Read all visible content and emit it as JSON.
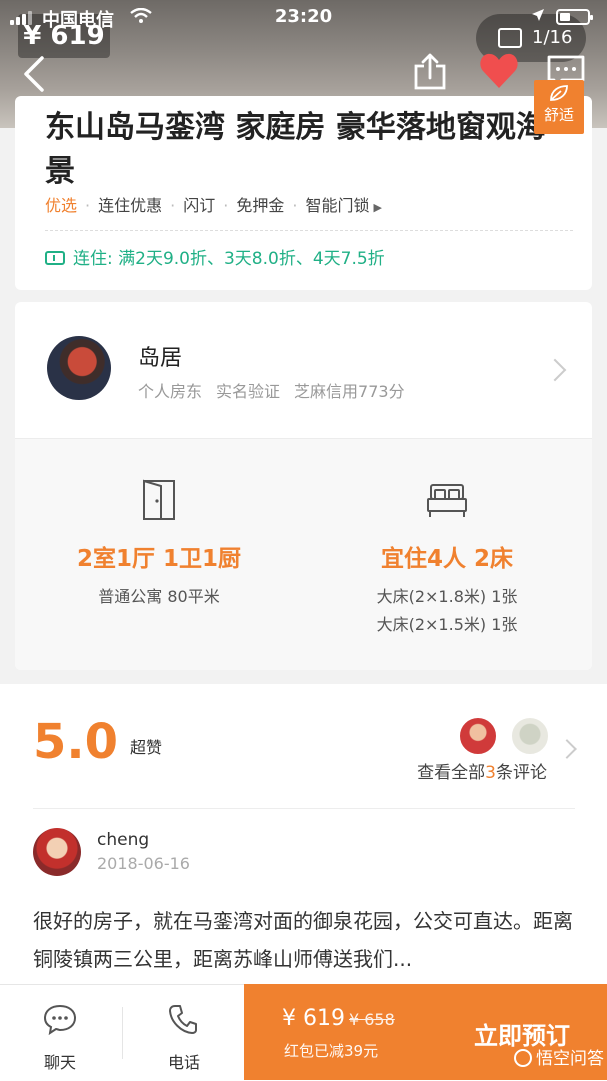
{
  "status_bar": {
    "carrier": "中国电信",
    "time": "23:20"
  },
  "gallery": {
    "price_overlay": "¥ 619",
    "photo_count": "1/16"
  },
  "badge": {
    "label": "舒适"
  },
  "listing": {
    "title": "东山岛马銮湾 家庭房 豪华落地窗观海景",
    "tags": [
      {
        "label": "优选"
      },
      {
        "label": "连住优惠"
      },
      {
        "label": "闪订"
      },
      {
        "label": "免押金"
      },
      {
        "label": "智能门锁"
      }
    ],
    "promo": "连住: 满2天9.0折、3天8.0折、4天7.5折"
  },
  "host": {
    "name": "岛居",
    "meta": [
      "个人房东",
      "实名验证",
      "芝麻信用773分"
    ]
  },
  "features": [
    {
      "icon": "door-icon",
      "headline": "2室1厅 1卫1厨",
      "lines": [
        "普通公寓 80平米"
      ]
    },
    {
      "icon": "bed-icon",
      "headline": "宜住4人 2床",
      "lines": [
        "大床(2×1.8米) 1张",
        "大床(2×1.5米) 1张"
      ]
    }
  ],
  "reviews": {
    "score": "5.0",
    "score_word": "超赞",
    "view_all_prefix": "查看全部",
    "count": "3",
    "view_all_suffix": "条评论",
    "items": [
      {
        "name": "cheng",
        "date": "2018-06-16",
        "text": "很好的房子，就在马銮湾对面的御泉花园，公交可直达。距离铜陵镇两三公里，距离苏峰山师傅送我们..."
      }
    ]
  },
  "bottom_bar": {
    "chat_label": "聊天",
    "phone_label": "电话",
    "price": "¥ 619",
    "old_price": "¥ 658",
    "discount_text": "红包已减39元",
    "book_label": "立即预订",
    "watermark": "悟空问答"
  },
  "colors": {
    "accent": "#f0812f",
    "promo_green": "#20b086",
    "favorite_red": "#f04e4e"
  }
}
